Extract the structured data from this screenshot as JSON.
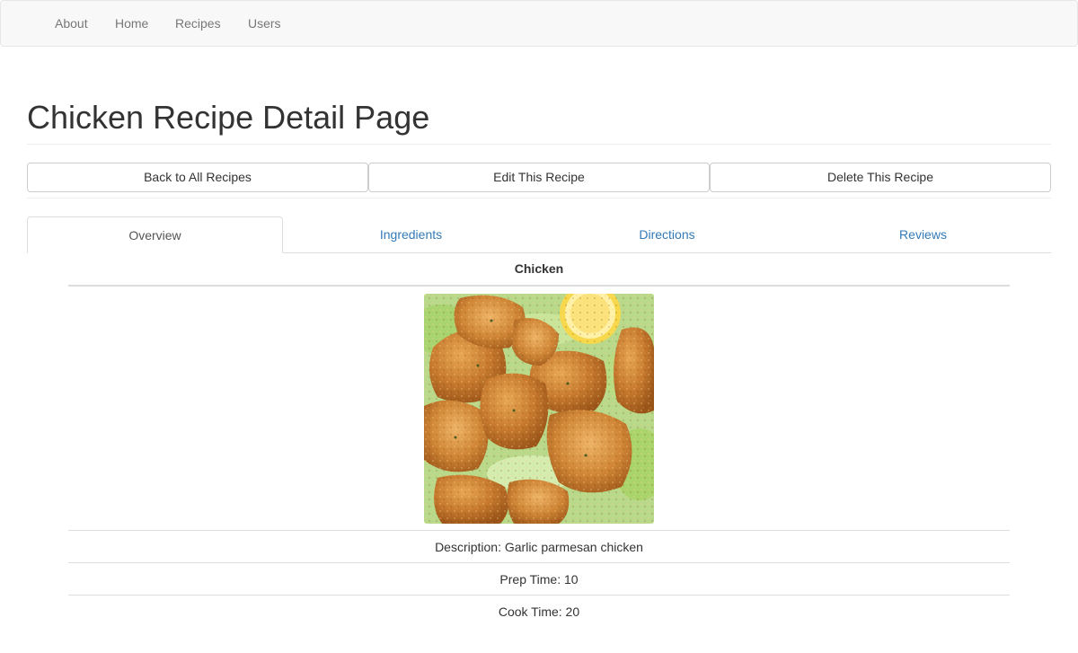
{
  "nav": {
    "items": [
      "About",
      "Home",
      "Recipes",
      "Users"
    ]
  },
  "page": {
    "title": "Chicken Recipe Detail Page"
  },
  "actions": {
    "back_label": "Back to All Recipes",
    "edit_label": "Edit This Recipe",
    "delete_label": "Delete This Recipe"
  },
  "tabs": {
    "items": [
      "Overview",
      "Ingredients",
      "Directions",
      "Reviews"
    ],
    "active": "Overview"
  },
  "recipe": {
    "name": "Chicken",
    "image_subject": "fried-chicken-photo",
    "description": "Description: Garlic parmesan chicken",
    "prep_time": "Prep Time: 10",
    "cook_time": "Cook Time: 20"
  },
  "colors": {
    "link": "#337ab7",
    "text": "#333333",
    "navbar_bg": "#f8f8f8"
  }
}
